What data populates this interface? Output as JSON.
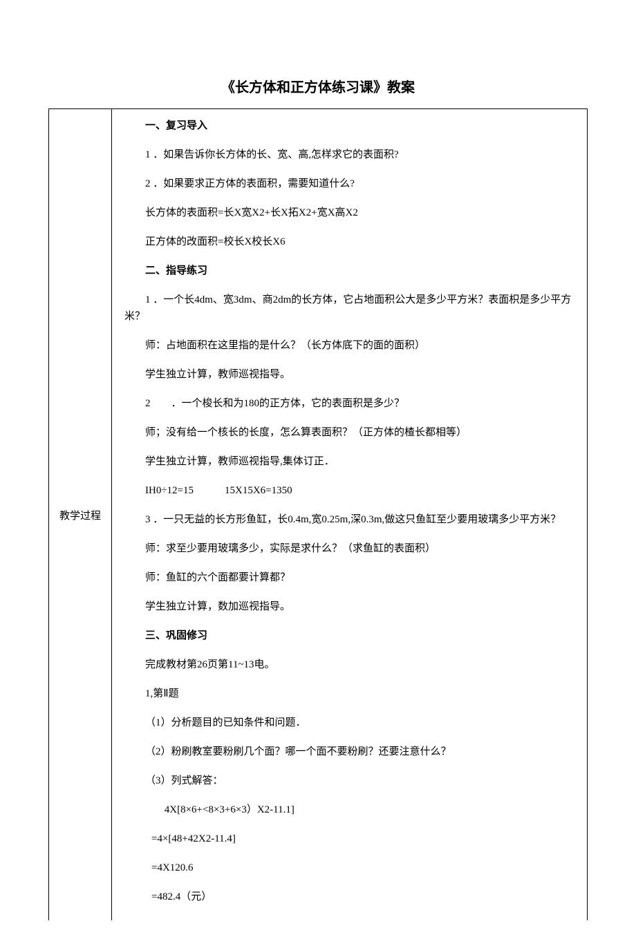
{
  "title": "《长方体和正方体练习课》教案",
  "leftLabel": "教学过程",
  "lines": {
    "s1_head": "一、复习导入",
    "s1_l1": "1 ．如果告诉你长方体的长、宽、高,怎样求它的表面积?",
    "s1_l2": "2 ．如果要求正方体的表面积，需要知道什么?",
    "s1_l3": "长方体的表面积=长X宽X2+长X拓X2+宽X高X2",
    "s1_l4": "正方体的改面积=校长X校长X6",
    "s2_head": "二、指导练习",
    "s2_l1": "1 ．一个长4dm、宽3dm、商2dm的长方体，它占地面积公大是多少平方米？表面枳是多少平方米？",
    "s2_l2": "师：占地面积在这里指的是什么？（长方体底下的面的面积）",
    "s2_l3": "学生独立计算，教师巡视指导。",
    "s2_l4": "2  ．一个梭长和为180的正方体，它的表面积是多少？",
    "s2_l5": "师；没有给一个核长的长度，怎么算表面积？（正方体的楂长都相等）",
    "s2_l6": "学生独立计算，教师巡视指导,集体订正．",
    "s2_l7": "IH0÷12=15   15X15X6=1350",
    "s2_l8": "3 ．一只无益的长方形鱼缸，长0.4m,宽0.25m,深0.3m,做这只鱼缸至少要用玻璃多少平方米？",
    "s2_l9": "师：求至少要用玻璃多少，实际是求什么？（求鱼缸的表面积）",
    "s2_l10": "师：鱼缸的六个面都要计算都？",
    "s2_l11": "学生独立计算，数加巡视指导。",
    "s3_head": "三、巩固修习",
    "s3_l1": "完成教材第26页第11~13电。",
    "s3_l2": "1,第Ⅱ题",
    "s3_l3": "（1）分析题目的已知条件和问题．",
    "s3_l4": "（2）粉刷教室要粉刷几个面？哪一个面不要粉刷？还要注意什么？",
    "s3_l5": "（3）列式解答：",
    "s3_l6": "  4X[8×6+<8×3+6×3）X2-11.1]",
    "s3_l7": "=4×[48+42X2-11.4]",
    "s3_l8": "=4X120.6",
    "s3_l9": "=482.4（元）"
  }
}
